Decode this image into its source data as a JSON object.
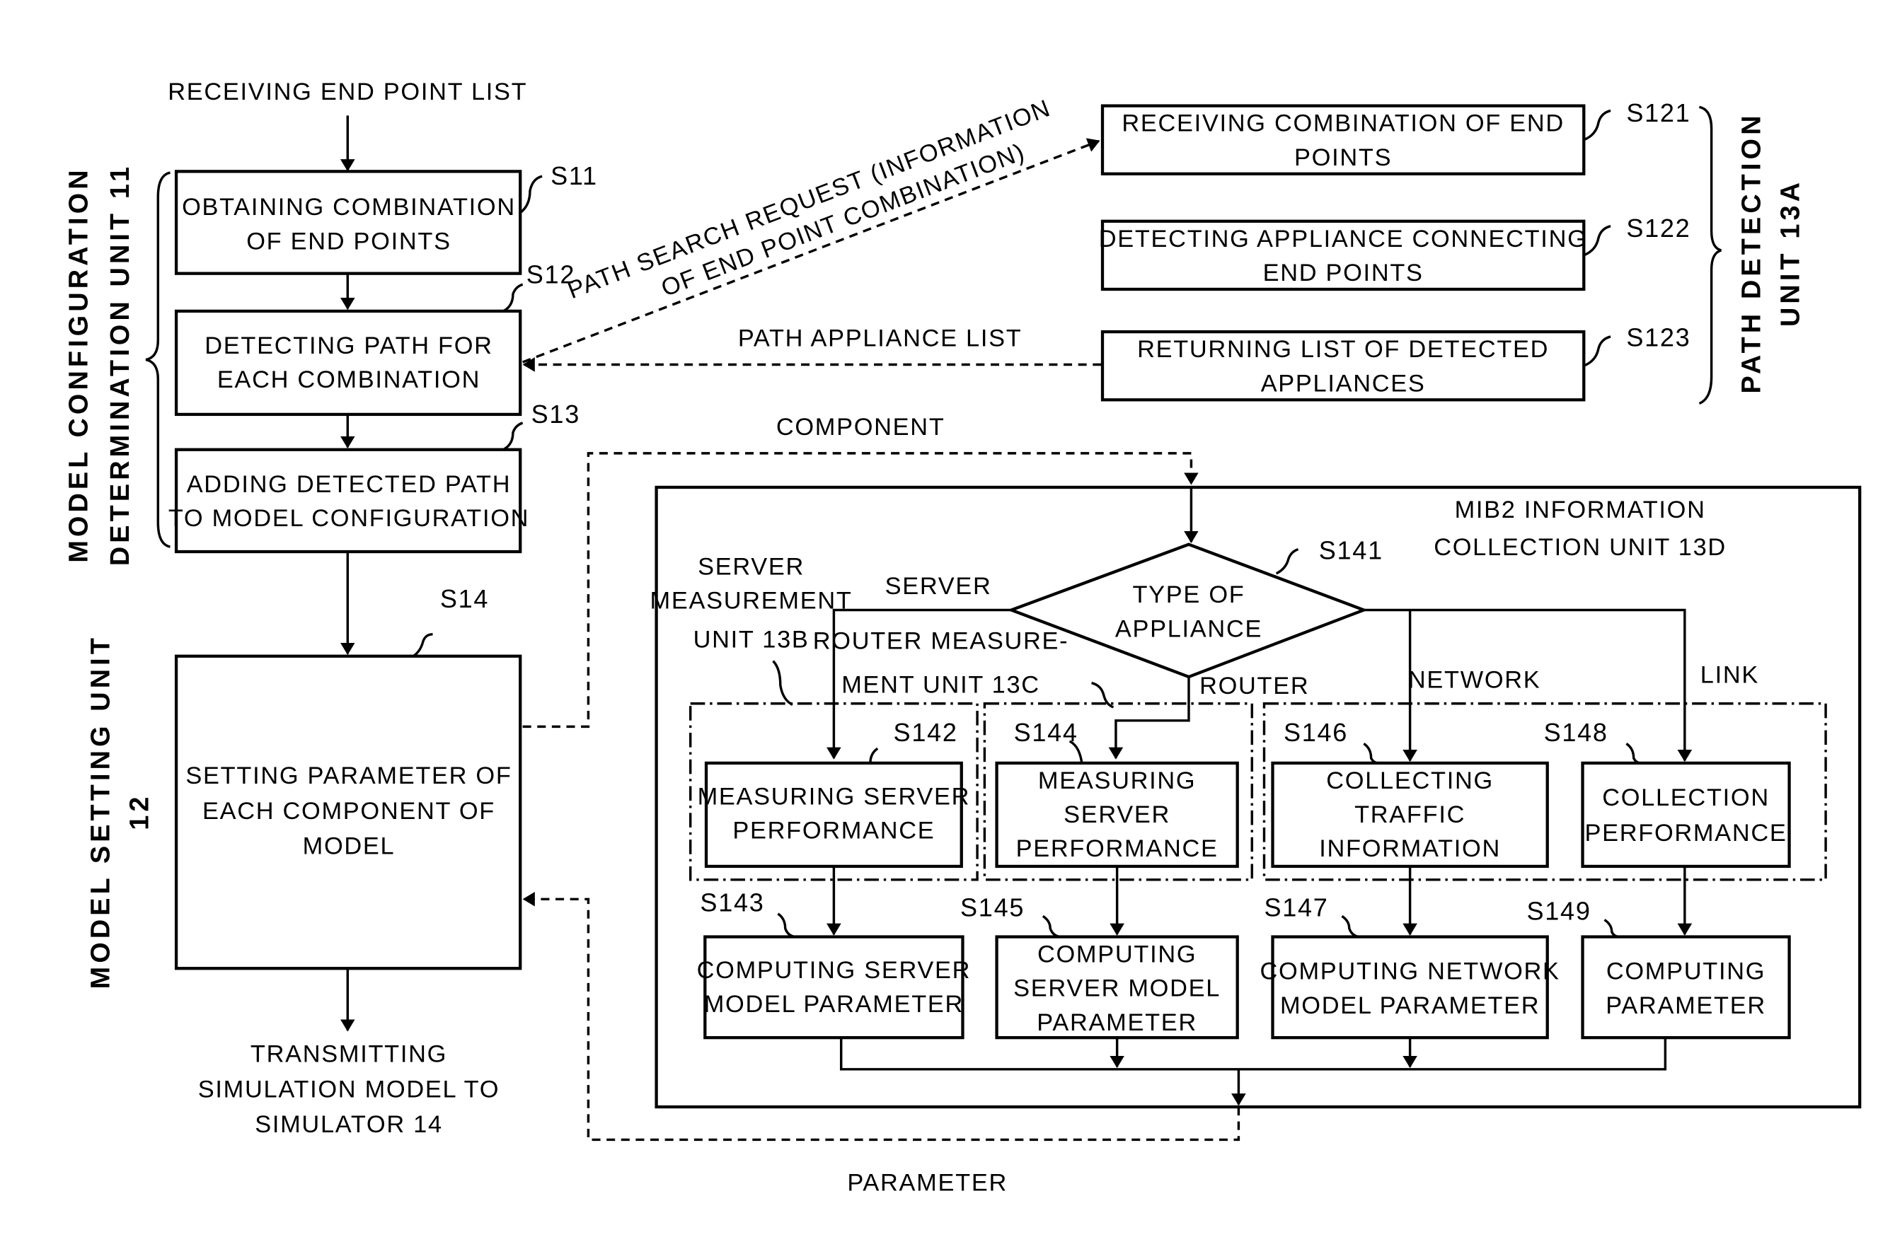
{
  "inputs": {
    "receiving_end_point_list": "RECEIVING END POINT LIST",
    "component": "COMPONENT",
    "parameter": "PARAMETER",
    "path_search_request": [
      "PATH SEARCH REQUEST (INFORMATION",
      "OF END POINT COMBINATION)"
    ],
    "path_appliance_list": "PATH APPLIANCE LIST"
  },
  "units": {
    "model_config": [
      "MODEL CONFIGURATION",
      "DETERMINATION  UNIT 11"
    ],
    "model_setting": [
      "MODEL SETTING UNIT",
      "12"
    ],
    "path_detection": [
      "PATH DETECTION",
      "UNIT 13A"
    ],
    "mib2": [
      "MIB2 INFORMATION",
      "COLLECTION UNIT 13D"
    ],
    "server_measurement": [
      "SERVER",
      "MEASUREMENT",
      "UNIT 13B"
    ],
    "router_measurement": [
      "ROUTER MEASURE-",
      "MENT UNIT 13C"
    ]
  },
  "steps": {
    "s11": {
      "id": "S11",
      "lines": [
        "OBTAINING COMBINATION",
        "OF END POINTS"
      ]
    },
    "s12": {
      "id": "S12",
      "lines": [
        "DETECTING PATH FOR",
        "EACH COMBINATION"
      ]
    },
    "s13": {
      "id": "S13",
      "lines": [
        "ADDING DETECTED PATH",
        "TO MODEL CONFIGURATION"
      ]
    },
    "s14": {
      "id": "S14",
      "lines": [
        "SETTING PARAMETER OF",
        "EACH COMPONENT OF",
        "MODEL"
      ]
    },
    "s121": {
      "id": "S121",
      "lines": [
        "RECEIVING COMBINATION OF END",
        "POINTS"
      ]
    },
    "s122": {
      "id": "S122",
      "lines": [
        "DETECTING APPLIANCE CONNECTING",
        "END POINTS"
      ]
    },
    "s123": {
      "id": "S123",
      "lines": [
        "RETURNING LIST OF DETECTED",
        "APPLIANCES"
      ]
    },
    "s141": {
      "id": "S141",
      "lines": [
        "TYPE OF",
        "APPLIANCE"
      ]
    },
    "s142": {
      "id": "S142",
      "lines": [
        "MEASURING SERVER",
        "PERFORMANCE"
      ]
    },
    "s143": {
      "id": "S143",
      "lines": [
        "COMPUTING SERVER",
        "MODEL PARAMETER"
      ]
    },
    "s144": {
      "id": "S144",
      "lines": [
        "MEASURING",
        "SERVER",
        "PERFORMANCE"
      ]
    },
    "s145": {
      "id": "S145",
      "lines": [
        "COMPUTING",
        "SERVER MODEL",
        "PARAMETER"
      ]
    },
    "s146": {
      "id": "S146",
      "lines": [
        "COLLECTING",
        "TRAFFIC",
        "INFORMATION"
      ]
    },
    "s147": {
      "id": "S147",
      "lines": [
        "COMPUTING NETWORK",
        "MODEL PARAMETER"
      ]
    },
    "s148": {
      "id": "S148",
      "lines": [
        "COLLECTION",
        "PERFORMANCE"
      ]
    },
    "s149": {
      "id": "S149",
      "lines": [
        "COMPUTING",
        "PARAMETER"
      ]
    }
  },
  "branches": {
    "server": "SERVER",
    "router": "ROUTER",
    "network": "NETWORK",
    "link": "LINK"
  },
  "output": [
    "TRANSMITTING",
    "SIMULATION MODEL TO",
    "SIMULATOR 14"
  ]
}
